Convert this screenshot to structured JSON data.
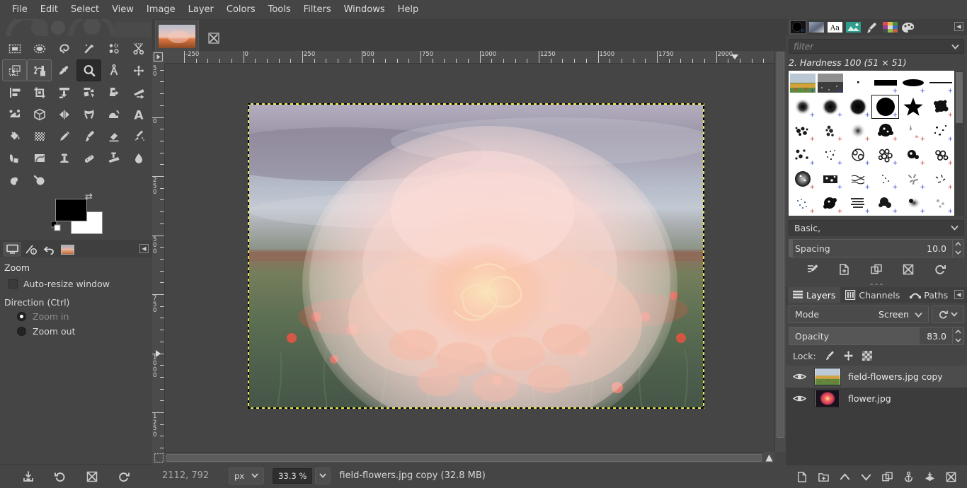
{
  "app": {
    "title": "GIMP"
  },
  "menubar": {
    "items": [
      {
        "label": "File"
      },
      {
        "label": "Edit"
      },
      {
        "label": "Select"
      },
      {
        "label": "View"
      },
      {
        "label": "Image"
      },
      {
        "label": "Layer"
      },
      {
        "label": "Colors"
      },
      {
        "label": "Tools"
      },
      {
        "label": "Filters"
      },
      {
        "label": "Windows"
      },
      {
        "label": "Help"
      }
    ]
  },
  "toolbox": {
    "tools": [
      {
        "name": "rect-select-icon",
        "title": "Rectangle Select",
        "state": "normal"
      },
      {
        "name": "ellipse-select-icon",
        "title": "Ellipse Select",
        "state": "normal"
      },
      {
        "name": "free-select-icon",
        "title": "Free Select",
        "state": "normal"
      },
      {
        "name": "fuzzy-select-icon",
        "title": "Fuzzy Select",
        "state": "normal"
      },
      {
        "name": "select-by-color-icon",
        "title": "Select by Color",
        "state": "normal"
      },
      {
        "name": "scissors-select-icon",
        "title": "Scissors Select",
        "state": "normal"
      },
      {
        "name": "foreground-select-icon",
        "title": "Foreground Select",
        "state": "outlined"
      },
      {
        "name": "paths-icon",
        "title": "Paths",
        "state": "outlined"
      },
      {
        "name": "color-picker-icon",
        "title": "Color Picker",
        "state": "normal"
      },
      {
        "name": "zoom-icon",
        "title": "Zoom",
        "state": "pressed"
      },
      {
        "name": "measure-icon",
        "title": "Measure",
        "state": "normal"
      },
      {
        "name": "move-icon",
        "title": "Move",
        "state": "normal"
      },
      {
        "name": "alignment-icon",
        "title": "Alignment",
        "state": "normal"
      },
      {
        "name": "crop-icon",
        "title": "Crop",
        "state": "normal"
      },
      {
        "name": "rotate-icon",
        "title": "Rotate",
        "state": "normal"
      },
      {
        "name": "scale-icon",
        "title": "Scale",
        "state": "normal"
      },
      {
        "name": "shear-icon",
        "title": "Shear",
        "state": "normal"
      },
      {
        "name": "perspective-icon",
        "title": "Perspective",
        "state": "normal"
      },
      {
        "name": "unified-transform-icon",
        "title": "Unified Transform",
        "state": "normal"
      },
      {
        "name": "handle-transform-icon",
        "title": "Handle Transform",
        "state": "normal"
      },
      {
        "name": "flip-icon",
        "title": "Flip",
        "state": "normal"
      },
      {
        "name": "cage-transform-icon",
        "title": "Cage Transform",
        "state": "normal"
      },
      {
        "name": "warp-transform-icon",
        "title": "Warp Transform",
        "state": "normal"
      },
      {
        "name": "text-icon",
        "title": "Text",
        "state": "normal"
      },
      {
        "name": "bucket-fill-icon",
        "title": "Bucket Fill",
        "state": "normal"
      },
      {
        "name": "gradient-icon",
        "title": "Gradient",
        "state": "normal"
      },
      {
        "name": "pencil-icon",
        "title": "Pencil",
        "state": "normal"
      },
      {
        "name": "paintbrush-icon",
        "title": "Paintbrush",
        "state": "normal"
      },
      {
        "name": "eraser-icon",
        "title": "Eraser",
        "state": "normal"
      },
      {
        "name": "airbrush-icon",
        "title": "Airbrush",
        "state": "normal"
      },
      {
        "name": "ink-icon",
        "title": "Ink",
        "state": "normal"
      },
      {
        "name": "mypaint-brush-icon",
        "title": "MyPaint Brush",
        "state": "normal"
      },
      {
        "name": "clone-icon",
        "title": "Clone",
        "state": "normal"
      },
      {
        "name": "heal-icon",
        "title": "Heal",
        "state": "normal"
      },
      {
        "name": "perspective-clone-icon",
        "title": "Perspective Clone",
        "state": "normal"
      },
      {
        "name": "blur-sharpen-icon",
        "title": "Blur / Sharpen",
        "state": "normal"
      },
      {
        "name": "smudge-icon",
        "title": "Smudge",
        "state": "normal"
      },
      {
        "name": "dodge-burn-icon",
        "title": "Dodge / Burn",
        "state": "normal"
      }
    ],
    "colors": {
      "foreground": "#000000",
      "background": "#ffffff",
      "swap_icon": "swap-colors-icon",
      "default_icon": "default-colors-icon"
    }
  },
  "tool_options": {
    "tabs": [
      {
        "name": "tool-options-tab",
        "icon": "tool-options-icon",
        "active": true
      },
      {
        "name": "device-status-tab",
        "icon": "device-status-icon",
        "active": false
      },
      {
        "name": "undo-history-tab",
        "icon": "undo-history-icon",
        "active": false
      },
      {
        "name": "images-tab",
        "icon": "images-thumbnail-icon",
        "active": false
      }
    ],
    "title": "Zoom",
    "auto_resize_label": "Auto-resize window",
    "auto_resize_checked": false,
    "direction_label": "Direction  (Ctrl)",
    "options": [
      {
        "label": "Zoom in",
        "selected": true,
        "dimmed": true
      },
      {
        "label": "Zoom out",
        "selected": false,
        "dimmed": false
      }
    ],
    "footer": [
      {
        "name": "save-tool-preset-button",
        "icon": "save-icon"
      },
      {
        "name": "restore-tool-preset-button",
        "icon": "restore-icon"
      },
      {
        "name": "delete-tool-preset-button",
        "icon": "delete-icon"
      },
      {
        "name": "reset-tool-options-button",
        "icon": "reset-icon"
      }
    ]
  },
  "image_window": {
    "tab": {
      "name": "image-tab",
      "close_icon": "close-icon"
    },
    "ruler_h": {
      "labels": [
        "-250",
        "0",
        "250",
        "500",
        "750",
        "1000",
        "1250",
        "1500",
        "1750",
        "2000"
      ]
    },
    "ruler_v": {
      "labels": [
        "-250",
        "0",
        "250",
        "500",
        "750",
        "1000",
        "1250"
      ]
    },
    "zoom_marker": "navigation-icon"
  },
  "statusbar": {
    "position": "2112, 792",
    "unit": "px",
    "zoom": "33.3 %",
    "message": "field-flowers.jpg copy (32.8 MB)"
  },
  "right_dock": {
    "tabs": [
      {
        "name": "brushes-tab",
        "icon": "brush-circle-icon",
        "active": true
      },
      {
        "name": "patterns-tab",
        "icon": "pattern-icon",
        "active": false
      },
      {
        "name": "fonts-tab",
        "icon": "font-aa-icon",
        "active": false
      },
      {
        "name": "document-history-tab",
        "icon": "image-icon",
        "active": false
      },
      {
        "name": "paint-dynamics-tab",
        "icon": "paintbrush-icon",
        "active": false
      },
      {
        "name": "palettes-tab",
        "icon": "palette-grid-icon",
        "active": false
      },
      {
        "name": "colormap-tab",
        "icon": "color-palette-icon",
        "active": false
      }
    ],
    "filter_placeholder": "filter",
    "brush_title": "2. Hardness 100 (51 × 51)",
    "brush_selected_index": 9,
    "preset_value": "Basic,",
    "spacing_label": "Spacing",
    "spacing_value": "10.0",
    "brush_footer": [
      {
        "name": "edit-brush-button",
        "icon": "edit-icon"
      },
      {
        "name": "new-brush-button",
        "icon": "new-document-icon"
      },
      {
        "name": "duplicate-brush-button",
        "icon": "duplicate-icon"
      },
      {
        "name": "delete-brush-button",
        "icon": "delete-icon"
      },
      {
        "name": "refresh-brushes-button",
        "icon": "refresh-icon"
      }
    ]
  },
  "layers_panel": {
    "tabs": [
      {
        "name": "tab-layers",
        "label": "Layers",
        "icon": "layers-icon",
        "active": true
      },
      {
        "name": "tab-channels",
        "label": "Channels",
        "icon": "channels-icon",
        "active": false
      },
      {
        "name": "tab-paths",
        "label": "Paths",
        "icon": "paths-icon",
        "active": false
      }
    ],
    "mode_label": "Mode",
    "mode_value": "Screen",
    "opacity_label": "Opacity",
    "opacity_value": "83.0",
    "lock_label": "Lock:",
    "lock_items": [
      {
        "name": "lock-pixels-button",
        "icon": "paintbrush-icon"
      },
      {
        "name": "lock-position-button",
        "icon": "move-icon"
      },
      {
        "name": "lock-alpha-button",
        "icon": "alpha-checker-icon"
      }
    ],
    "layers": [
      {
        "name": "field-flowers.jpg copy",
        "visible": true,
        "selected": true,
        "thumb": "landscape"
      },
      {
        "name": "flower.jpg",
        "visible": true,
        "selected": false,
        "thumb": "flower"
      }
    ],
    "footer": [
      {
        "name": "new-layer-button",
        "icon": "new-document-icon"
      },
      {
        "name": "new-layer-group-button",
        "icon": "new-folder-icon"
      },
      {
        "name": "raise-layer-button",
        "icon": "chevron-up-icon"
      },
      {
        "name": "lower-layer-button",
        "icon": "chevron-down-icon"
      },
      {
        "name": "duplicate-layer-button",
        "icon": "duplicate-icon"
      },
      {
        "name": "anchor-layer-button",
        "icon": "anchor-icon"
      },
      {
        "name": "merge-down-button",
        "icon": "merge-down-icon"
      },
      {
        "name": "delete-layer-button",
        "icon": "delete-icon"
      }
    ]
  }
}
